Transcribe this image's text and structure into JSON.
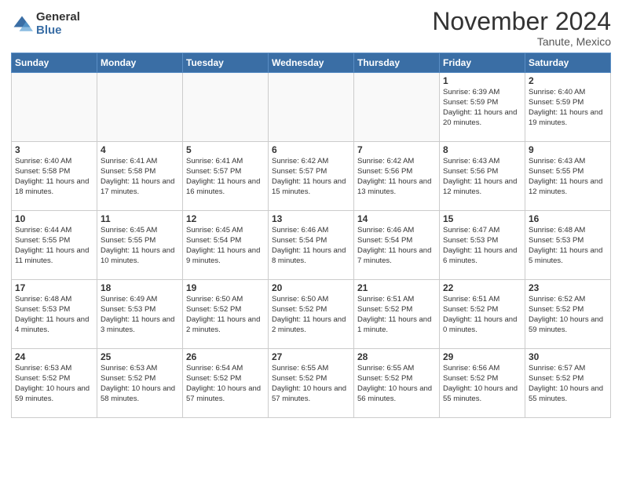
{
  "logo": {
    "general": "General",
    "blue": "Blue"
  },
  "header": {
    "month": "November 2024",
    "location": "Tanute, Mexico"
  },
  "weekdays": [
    "Sunday",
    "Monday",
    "Tuesday",
    "Wednesday",
    "Thursday",
    "Friday",
    "Saturday"
  ],
  "weeks": [
    [
      {
        "day": "",
        "empty": true
      },
      {
        "day": "",
        "empty": true
      },
      {
        "day": "",
        "empty": true
      },
      {
        "day": "",
        "empty": true
      },
      {
        "day": "",
        "empty": true
      },
      {
        "day": "1",
        "sunrise": "6:39 AM",
        "sunset": "5:59 PM",
        "daylight": "11 hours and 20 minutes."
      },
      {
        "day": "2",
        "sunrise": "6:40 AM",
        "sunset": "5:59 PM",
        "daylight": "11 hours and 19 minutes."
      }
    ],
    [
      {
        "day": "3",
        "sunrise": "6:40 AM",
        "sunset": "5:58 PM",
        "daylight": "11 hours and 18 minutes."
      },
      {
        "day": "4",
        "sunrise": "6:41 AM",
        "sunset": "5:58 PM",
        "daylight": "11 hours and 17 minutes."
      },
      {
        "day": "5",
        "sunrise": "6:41 AM",
        "sunset": "5:57 PM",
        "daylight": "11 hours and 16 minutes."
      },
      {
        "day": "6",
        "sunrise": "6:42 AM",
        "sunset": "5:57 PM",
        "daylight": "11 hours and 15 minutes."
      },
      {
        "day": "7",
        "sunrise": "6:42 AM",
        "sunset": "5:56 PM",
        "daylight": "11 hours and 13 minutes."
      },
      {
        "day": "8",
        "sunrise": "6:43 AM",
        "sunset": "5:56 PM",
        "daylight": "11 hours and 12 minutes."
      },
      {
        "day": "9",
        "sunrise": "6:43 AM",
        "sunset": "5:55 PM",
        "daylight": "11 hours and 12 minutes."
      }
    ],
    [
      {
        "day": "10",
        "sunrise": "6:44 AM",
        "sunset": "5:55 PM",
        "daylight": "11 hours and 11 minutes."
      },
      {
        "day": "11",
        "sunrise": "6:45 AM",
        "sunset": "5:55 PM",
        "daylight": "11 hours and 10 minutes."
      },
      {
        "day": "12",
        "sunrise": "6:45 AM",
        "sunset": "5:54 PM",
        "daylight": "11 hours and 9 minutes."
      },
      {
        "day": "13",
        "sunrise": "6:46 AM",
        "sunset": "5:54 PM",
        "daylight": "11 hours and 8 minutes."
      },
      {
        "day": "14",
        "sunrise": "6:46 AM",
        "sunset": "5:54 PM",
        "daylight": "11 hours and 7 minutes."
      },
      {
        "day": "15",
        "sunrise": "6:47 AM",
        "sunset": "5:53 PM",
        "daylight": "11 hours and 6 minutes."
      },
      {
        "day": "16",
        "sunrise": "6:48 AM",
        "sunset": "5:53 PM",
        "daylight": "11 hours and 5 minutes."
      }
    ],
    [
      {
        "day": "17",
        "sunrise": "6:48 AM",
        "sunset": "5:53 PM",
        "daylight": "11 hours and 4 minutes."
      },
      {
        "day": "18",
        "sunrise": "6:49 AM",
        "sunset": "5:53 PM",
        "daylight": "11 hours and 3 minutes."
      },
      {
        "day": "19",
        "sunrise": "6:50 AM",
        "sunset": "5:52 PM",
        "daylight": "11 hours and 2 minutes."
      },
      {
        "day": "20",
        "sunrise": "6:50 AM",
        "sunset": "5:52 PM",
        "daylight": "11 hours and 2 minutes."
      },
      {
        "day": "21",
        "sunrise": "6:51 AM",
        "sunset": "5:52 PM",
        "daylight": "11 hours and 1 minute."
      },
      {
        "day": "22",
        "sunrise": "6:51 AM",
        "sunset": "5:52 PM",
        "daylight": "11 hours and 0 minutes."
      },
      {
        "day": "23",
        "sunrise": "6:52 AM",
        "sunset": "5:52 PM",
        "daylight": "10 hours and 59 minutes."
      }
    ],
    [
      {
        "day": "24",
        "sunrise": "6:53 AM",
        "sunset": "5:52 PM",
        "daylight": "10 hours and 59 minutes."
      },
      {
        "day": "25",
        "sunrise": "6:53 AM",
        "sunset": "5:52 PM",
        "daylight": "10 hours and 58 minutes."
      },
      {
        "day": "26",
        "sunrise": "6:54 AM",
        "sunset": "5:52 PM",
        "daylight": "10 hours and 57 minutes."
      },
      {
        "day": "27",
        "sunrise": "6:55 AM",
        "sunset": "5:52 PM",
        "daylight": "10 hours and 57 minutes."
      },
      {
        "day": "28",
        "sunrise": "6:55 AM",
        "sunset": "5:52 PM",
        "daylight": "10 hours and 56 minutes."
      },
      {
        "day": "29",
        "sunrise": "6:56 AM",
        "sunset": "5:52 PM",
        "daylight": "10 hours and 55 minutes."
      },
      {
        "day": "30",
        "sunrise": "6:57 AM",
        "sunset": "5:52 PM",
        "daylight": "10 hours and 55 minutes."
      }
    ]
  ]
}
